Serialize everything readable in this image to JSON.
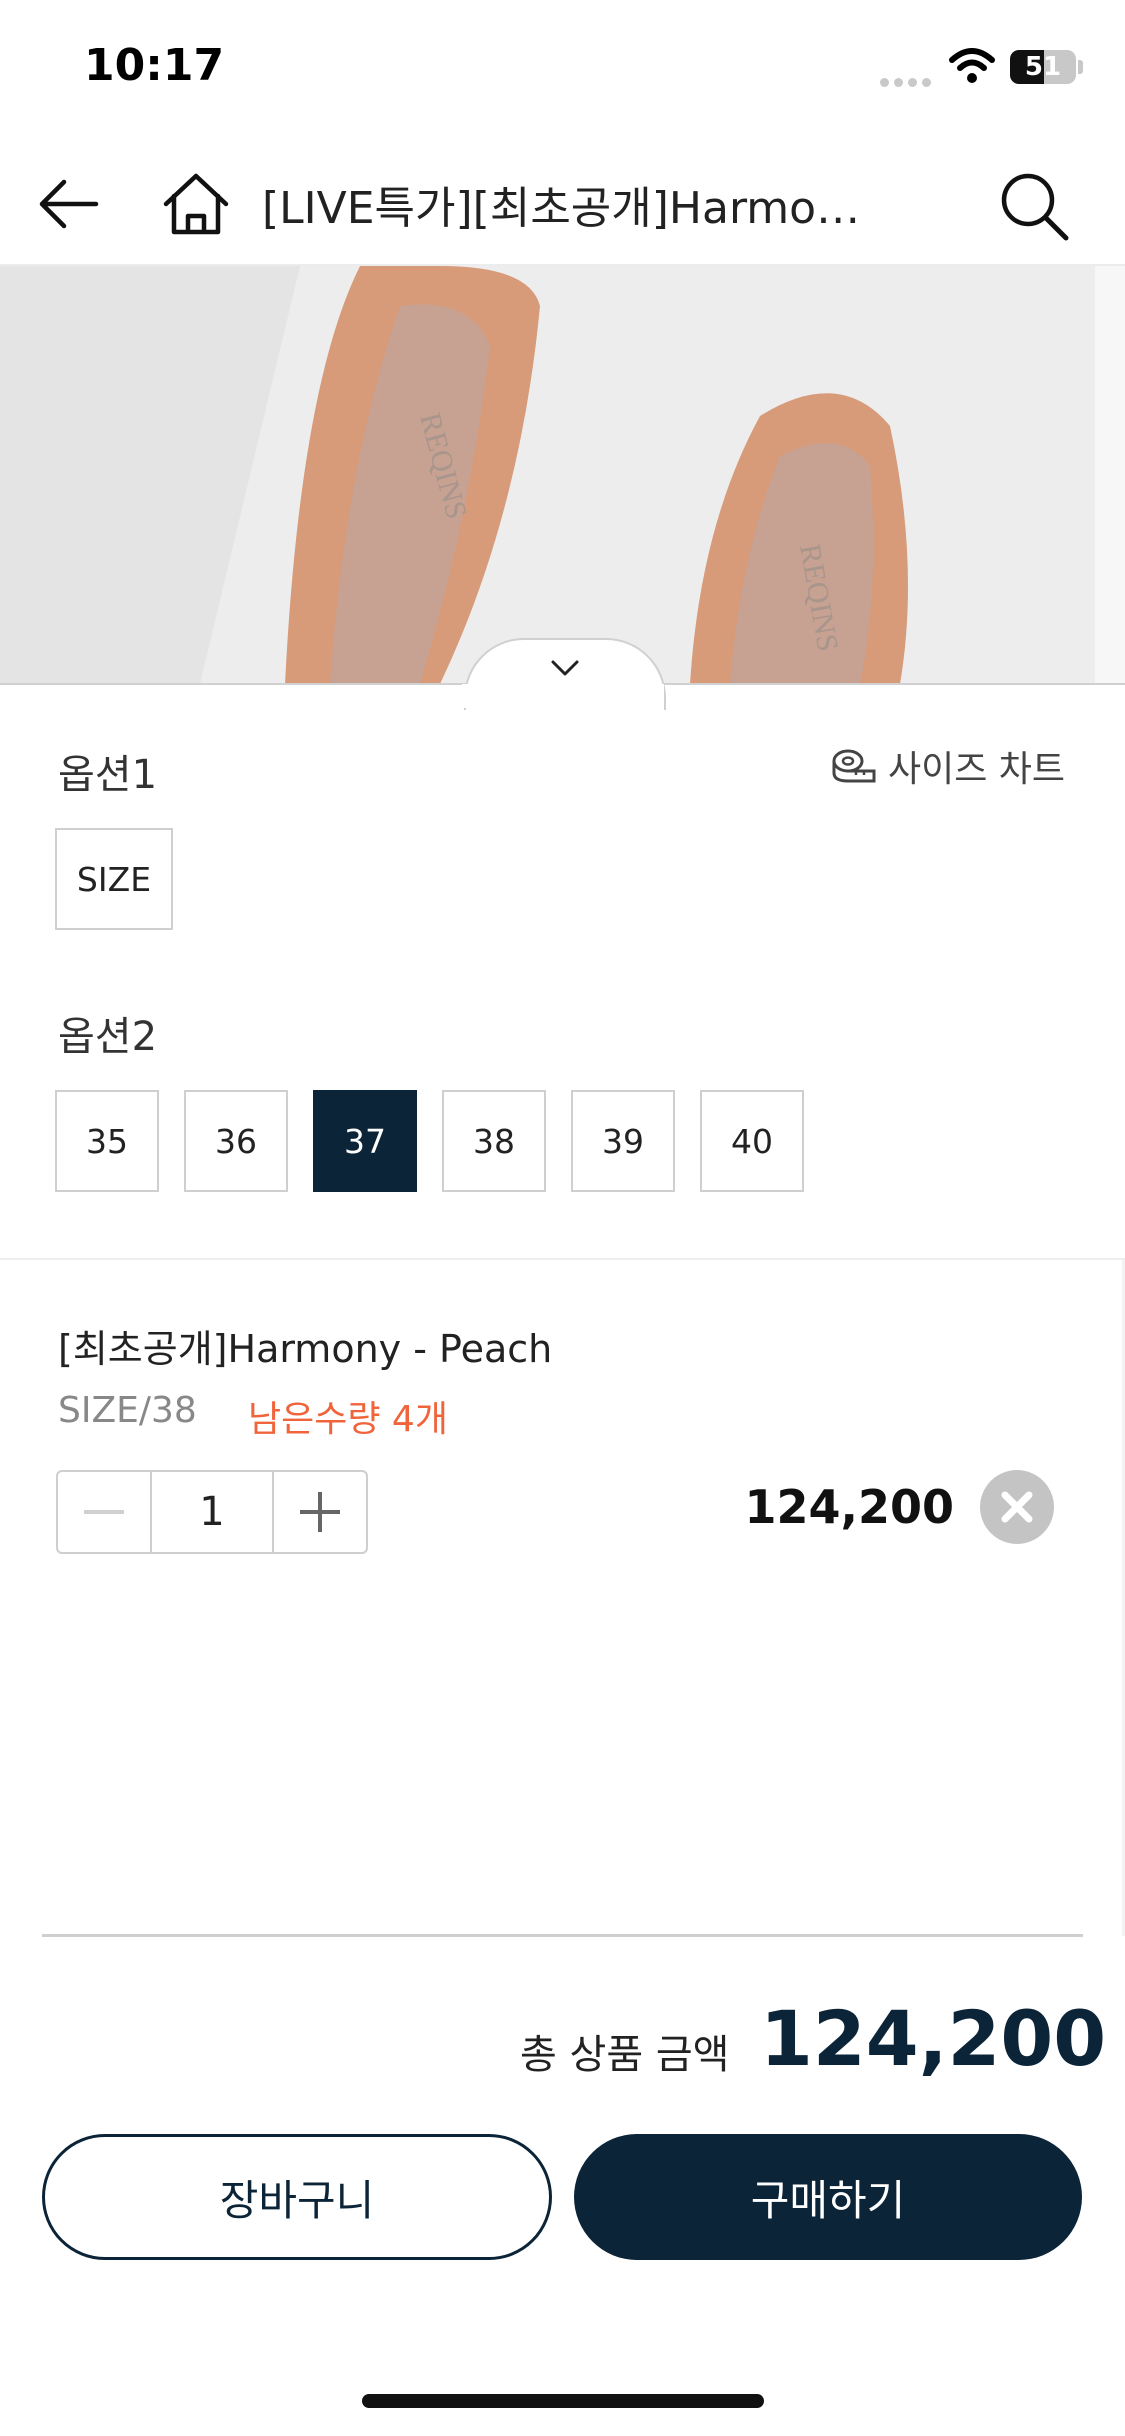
{
  "status_bar": {
    "time": "10:17",
    "battery": "51"
  },
  "nav": {
    "title": "[LIVE특가][최초공개]Harmony - Peach",
    "back_icon": "arrow-left-icon",
    "home_icon": "home-icon",
    "search_icon": "search-icon"
  },
  "product_image": {
    "alt": "peach suede flat shoes",
    "brand_mark": "REQINS"
  },
  "options": {
    "option1": {
      "label": "옵션1",
      "size_chart_label": "사이즈 차트",
      "values": [
        "SIZE"
      ]
    },
    "option2": {
      "label": "옵션2",
      "values": [
        "35",
        "36",
        "37",
        "38",
        "39",
        "40"
      ],
      "selected": "37"
    }
  },
  "selected_item": {
    "name": "[최초공개]Harmony - Peach",
    "option": "SIZE/38",
    "stock": "남은수량 4개",
    "quantity": "1",
    "price": "124,200"
  },
  "total": {
    "label": "총 상품 금액",
    "amount": "124,200"
  },
  "actions": {
    "cart_label": "장바구니",
    "buy_label": "구매하기"
  },
  "colors": {
    "primary": "#0c2438",
    "accent": "#f0643c",
    "border": "#cfcfcf"
  }
}
